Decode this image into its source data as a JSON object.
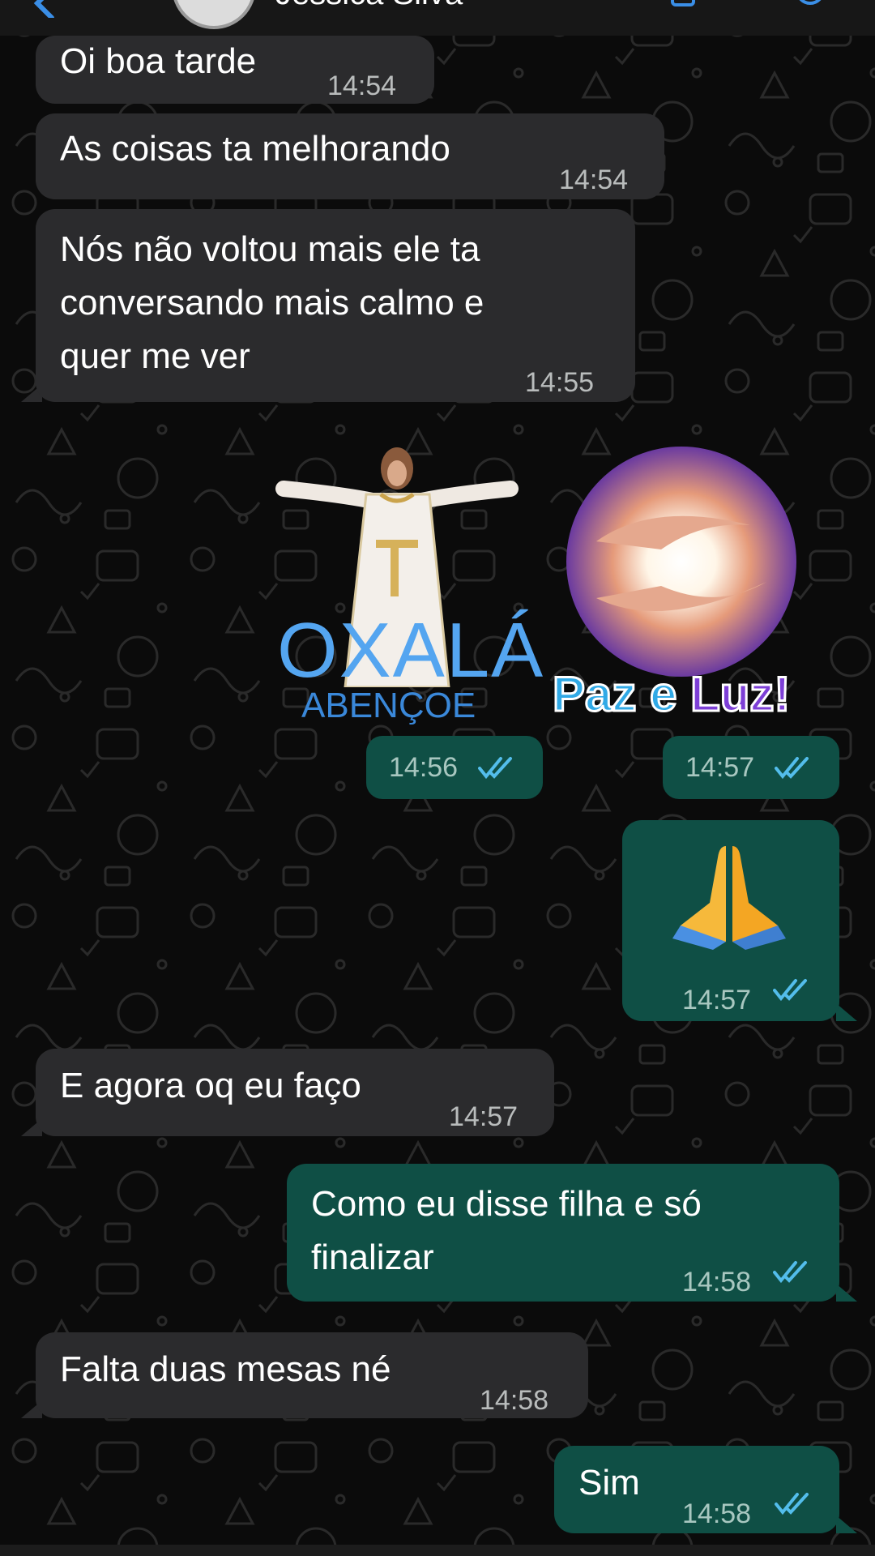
{
  "header": {
    "contact_name": "Jessica Silva",
    "back_icon": "chevron-left-icon",
    "video_icon": "video-camera-icon",
    "call_icon": "phone-icon"
  },
  "colors": {
    "background": "#0b0b0b",
    "incoming_bubble": "#2b2b2d",
    "outgoing_bubble": "#0f4f45",
    "read_ticks": "#53bdeb",
    "timestamp": "#b9bcbc"
  },
  "messages": [
    {
      "direction": "incoming",
      "text": "Oi boa tarde",
      "time": "14:54"
    },
    {
      "direction": "incoming",
      "text": "As coisas ta melhorando",
      "time": "14:54"
    },
    {
      "direction": "incoming",
      "lines": [
        "Nós não voltou mais ele ta",
        "conversando mais calmo e",
        "quer me ver"
      ],
      "time": "14:55"
    },
    {
      "direction": "outgoing",
      "type": "sticker",
      "sticker_text": "OXALÁ",
      "sticker_subtext": "ABENÇOE",
      "time": "14:56",
      "status": "read"
    },
    {
      "direction": "outgoing",
      "type": "sticker",
      "sticker_text": "Paz e Luz!",
      "time": "14:57",
      "status": "read"
    },
    {
      "direction": "outgoing",
      "type": "emoji",
      "emoji": "folded-hands",
      "time": "14:57",
      "status": "read"
    },
    {
      "direction": "incoming",
      "text": "E agora oq eu faço",
      "time": "14:57"
    },
    {
      "direction": "outgoing",
      "lines": [
        "Como eu disse filha e só",
        "finalizar"
      ],
      "time": "14:58",
      "status": "read"
    },
    {
      "direction": "incoming",
      "text": "Falta duas mesas né",
      "time": "14:58"
    },
    {
      "direction": "outgoing",
      "text": "Sim",
      "time": "14:58",
      "status": "read"
    }
  ]
}
